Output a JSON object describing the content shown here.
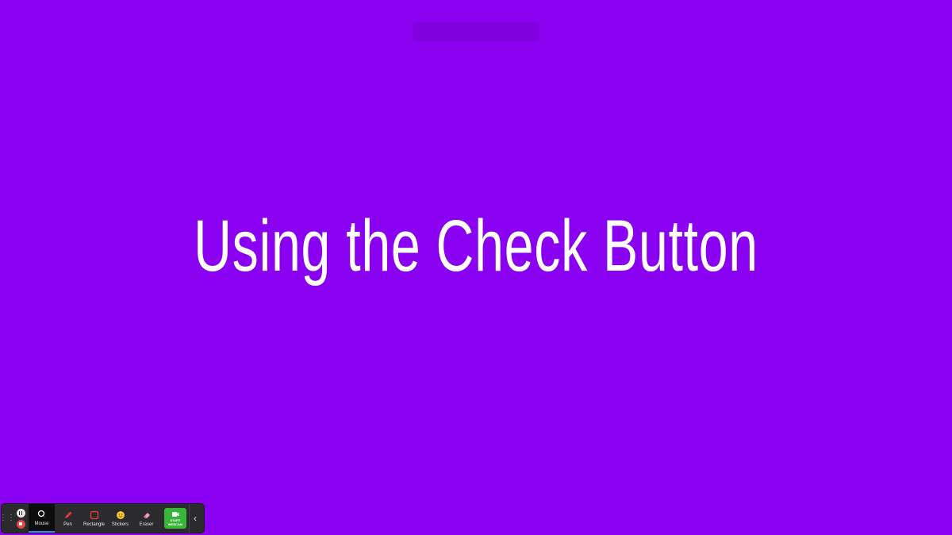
{
  "slide": {
    "title": "Using the Check Button",
    "background_color": "#8a00f0"
  },
  "toolbar": {
    "tools": [
      {
        "label": "Mouse",
        "icon": "cursor-icon",
        "active": true
      },
      {
        "label": "Pen",
        "icon": "pen-icon"
      },
      {
        "label": "Rectangle",
        "icon": "rectangle-icon"
      },
      {
        "label": "Stickers",
        "icon": "smiley-icon"
      },
      {
        "label": "Eraser",
        "icon": "eraser-icon"
      }
    ],
    "webcam_label_1": "START",
    "webcam_label_2": "WEBCAM",
    "accent_color": "#2d8cff",
    "webcam_color": "#38b63a"
  }
}
